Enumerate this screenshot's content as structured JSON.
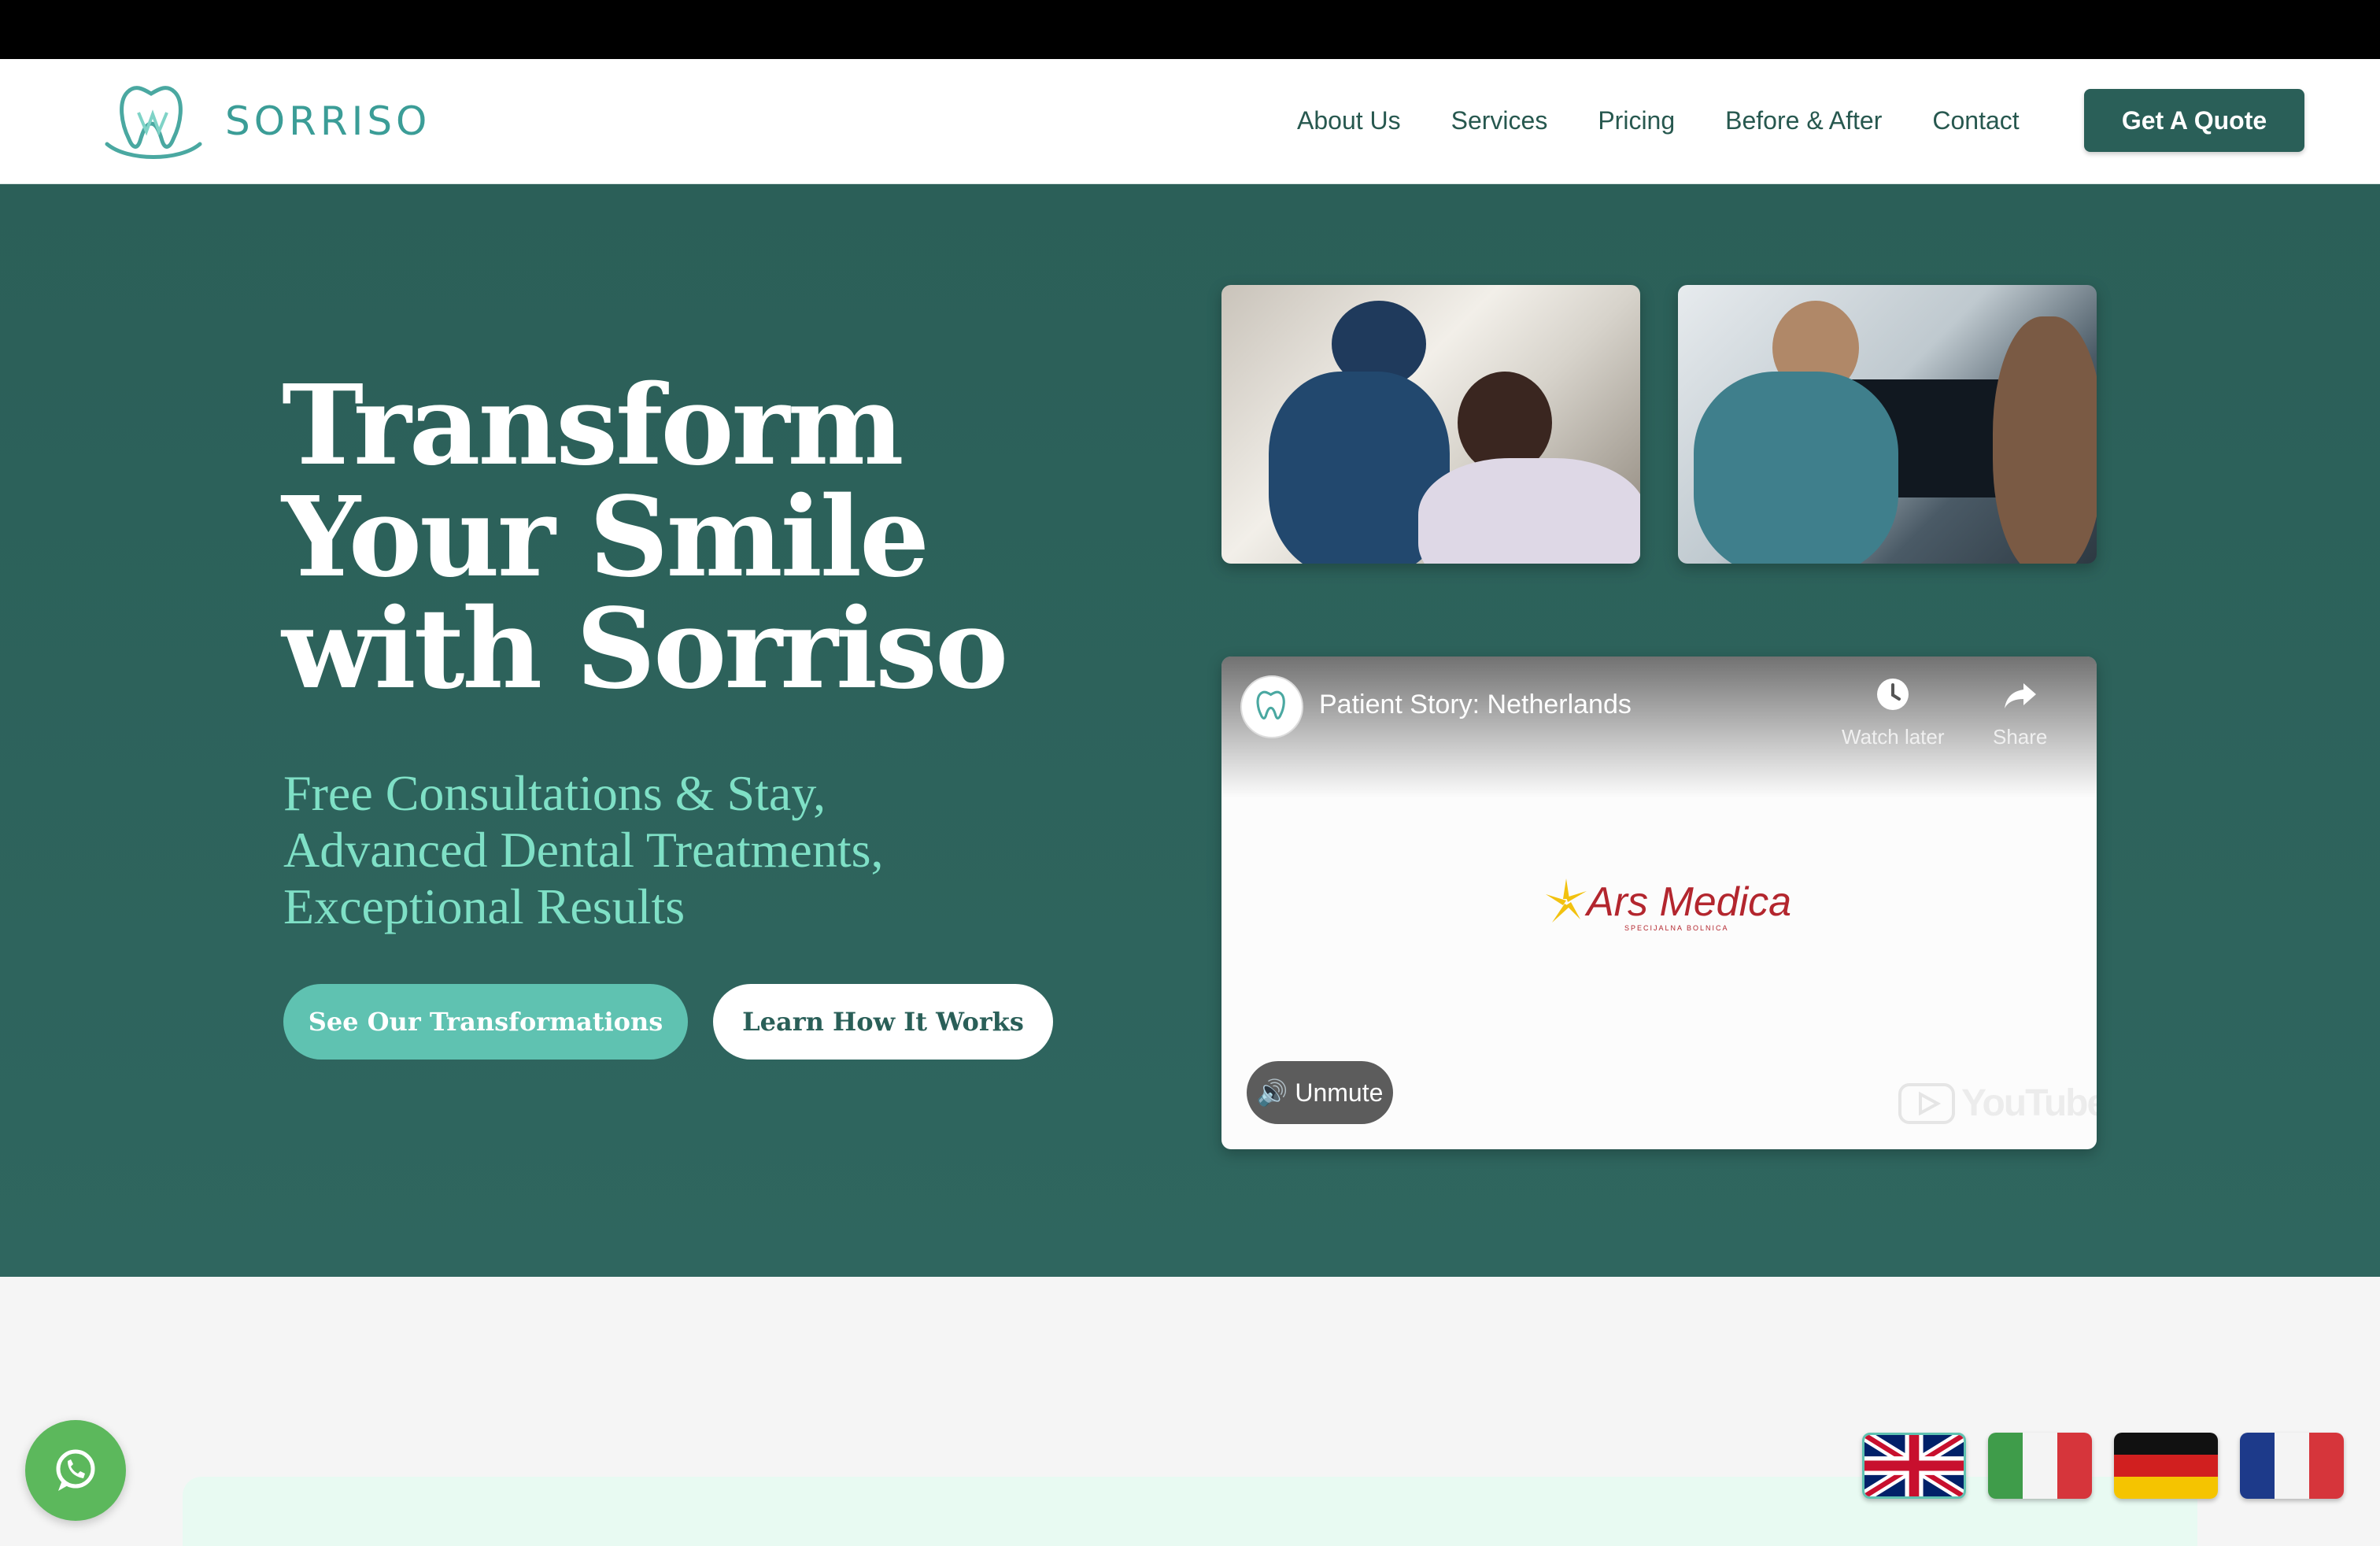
{
  "brand": {
    "name": "SORRISO",
    "accent": "#3b9d97",
    "dark": "#2a5f58",
    "mint": "#7fe0c6"
  },
  "nav": {
    "items": [
      "About Us",
      "Services",
      "Pricing",
      "Before & After",
      "Contact"
    ],
    "cta": "Get A Quote"
  },
  "hero": {
    "title_lines": [
      "Transform",
      "Your Smile",
      "with Sorriso"
    ],
    "subtitle_lines": [
      "Free Consultations & Stay,",
      "Advanced Dental Treatments,",
      "Exceptional Results"
    ],
    "primary_button": "See Our Transformations",
    "secondary_button": "Learn How It Works"
  },
  "video": {
    "title": "Patient Story: Netherlands",
    "watch_later": "Watch later",
    "share": "Share",
    "logo_text": "Ars Medica",
    "logo_sub": "SPECIJALNA BOLNICA",
    "unmute": "🔊 Unmute",
    "youtube": "YouTube"
  },
  "icons": {
    "whatsapp": "whatsapp-icon",
    "clock": "clock-icon",
    "share": "share-icon"
  },
  "languages": [
    "English",
    "Italiano",
    "Deutsch",
    "Français"
  ]
}
